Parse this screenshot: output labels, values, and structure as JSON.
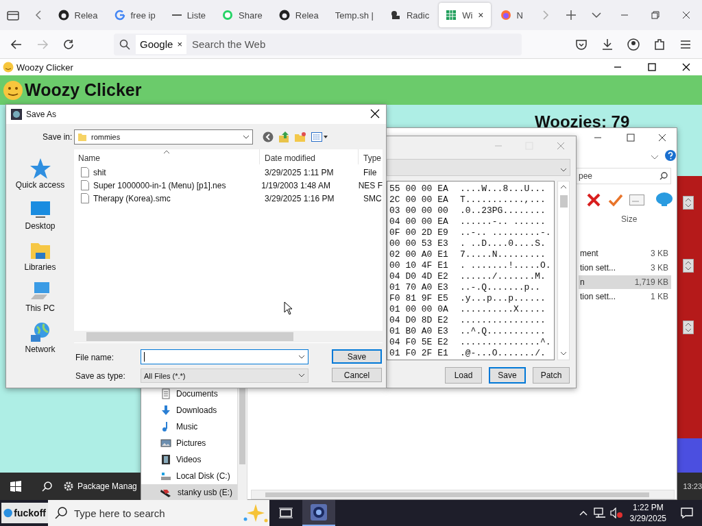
{
  "browser": {
    "tabs": [
      {
        "label": "Relea",
        "selected": false
      },
      {
        "label": "free ip",
        "selected": false
      },
      {
        "label": "Liste",
        "selected": false
      },
      {
        "label": "Share",
        "selected": false
      },
      {
        "label": "Relea",
        "selected": false
      },
      {
        "label": "Temp.sh |",
        "selected": false
      },
      {
        "label": "Radic",
        "selected": false
      },
      {
        "label": "Wi",
        "selected": true
      },
      {
        "label": "N",
        "selected": false
      }
    ],
    "close_mark": "×",
    "forward_disabled": true,
    "engine": "Google",
    "engine_clear": "×",
    "placeholder": "Search the Web"
  },
  "app_window": {
    "title": "Woozy Clicker"
  },
  "page": {
    "heading": "Woozy Clicker",
    "counter": "Woozies: 79"
  },
  "explorer": {
    "search": "pee",
    "size_column": "Size",
    "rows": [
      {
        "name": "ment",
        "size": "3 KB",
        "selected": false
      },
      {
        "name": "tion sett...",
        "size": "3 KB",
        "selected": false
      },
      {
        "name": "n",
        "size": "1,719 KB",
        "selected": true
      },
      {
        "name": "tion sett...",
        "size": "1 KB",
        "selected": false
      }
    ],
    "nav_items": [
      {
        "label": "Documents",
        "selected": false
      },
      {
        "label": "Downloads",
        "selected": false
      },
      {
        "label": "Music",
        "selected": false
      },
      {
        "label": "Pictures",
        "selected": false
      },
      {
        "label": "Videos",
        "selected": false
      },
      {
        "label": "Local Disk (C:)",
        "selected": false
      },
      {
        "label": "stanky usb (E:)",
        "selected": true
      }
    ]
  },
  "hex_editor": {
    "rows": [
      {
        "bytes": "55 00 00 EA",
        "ascii": "....W...8...U..."
      },
      {
        "bytes": "2C 00 00 EA",
        "ascii": "T...........,..."
      },
      {
        "bytes": "03 00 00 00",
        "ascii": ".0..23PG........"
      },
      {
        "bytes": "04 00 00 EA",
        "ascii": "......-.. ......"
      },
      {
        "bytes": "0F 00 2D E9",
        "ascii": "..-.. .........-."
      },
      {
        "bytes": "00 00 53 E3",
        "ascii": ". ..D....0....S."
      },
      {
        "bytes": "02 00 A0 E1",
        "ascii": "7.....N........."
      },
      {
        "bytes": "00 10 4F E1",
        "ascii": ". .......!.....O."
      },
      {
        "bytes": "04 D0 4D E2",
        "ascii": "....../.......M."
      },
      {
        "bytes": "01 70 A0 E3",
        "ascii": "..-.Q.......p.."
      },
      {
        "bytes": "F0 81 9F E5",
        "ascii": ".y...p...p......"
      },
      {
        "bytes": "01 00 00 0A",
        "ascii": "..........X....."
      },
      {
        "bytes": "04 D0 8D E2",
        "ascii": "................"
      },
      {
        "bytes": "01 B0 A0 E3",
        "ascii": "..^.Q..........."
      },
      {
        "bytes": "04 F0 5E E2",
        "ascii": "...............^."
      },
      {
        "bytes": "01 F0 2F E1",
        "ascii": ".@-...O......./."
      }
    ],
    "buttons": [
      {
        "label": "Load",
        "default": false
      },
      {
        "label": "Save",
        "default": true
      },
      {
        "label": "Patch",
        "default": false
      }
    ]
  },
  "save_dialog": {
    "title": "Save As",
    "save_in_label": "Save in:",
    "save_in": "rommies",
    "places": [
      "Quick access",
      "Desktop",
      "Libraries",
      "This PC",
      "Network"
    ],
    "columns": [
      "Name",
      "Date modified",
      "Type"
    ],
    "files": [
      {
        "name": "shit",
        "date": "3/29/2025 1:11 PM",
        "type": "File"
      },
      {
        "name": "Super 1000000-in-1 (Menu) [p1].nes",
        "date": "1/19/2003 1:48 AM",
        "type": "NES F"
      },
      {
        "name": "Therapy (Korea).smc",
        "date": "3/29/2025 1:16 PM",
        "type": "SMC"
      }
    ],
    "file_name_label": "File name:",
    "type_label": "Save as type:",
    "type_value": "All Files (*.*)",
    "buttons": [
      {
        "label": "Save",
        "default": true
      },
      {
        "label": "Cancel",
        "default": false
      }
    ]
  },
  "inner_taskbar": {
    "app": "Package Manag",
    "clock": "13:23"
  },
  "taskbar": {
    "start_label": "fuckoff",
    "search_placeholder": "Type here to search",
    "apps": [
      {
        "kind": "task_view",
        "selected": false
      },
      {
        "kind": "media",
        "selected": true
      }
    ],
    "time": "1:22 PM",
    "date": "3/29/2025"
  }
}
